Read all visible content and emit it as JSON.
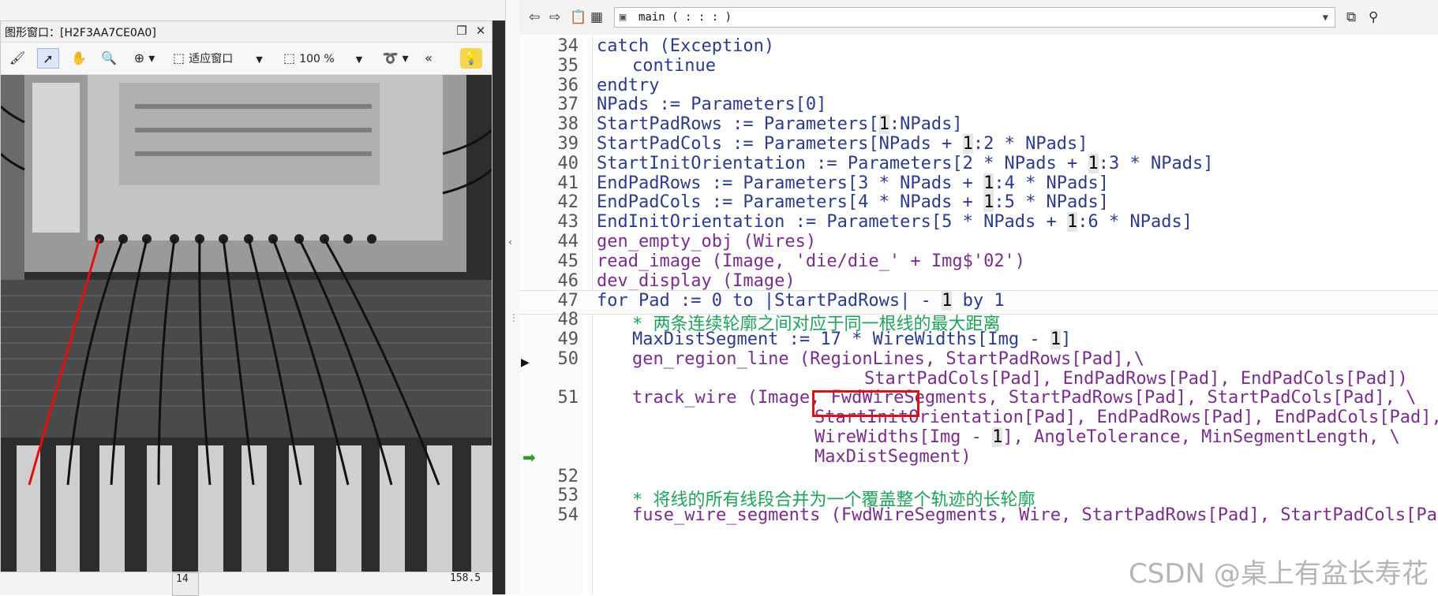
{
  "graphics_window": {
    "title": "图形窗口：[H2F3AA7CE0A0]",
    "tools": {
      "fit_label": "适应窗口",
      "zoom_label": "100 %",
      "more": "«"
    },
    "icons": [
      "restore-icon",
      "close-icon",
      "brush-icon",
      "pointer-icon",
      "hand-icon",
      "magnifier-icon",
      "zoom-in-icon",
      "fit-window-icon",
      "zoom-percent-icon",
      "lasso-icon",
      "lightbulb-icon"
    ]
  },
  "background_table": {
    "row_number": "14",
    "row_value": "158.5"
  },
  "editor": {
    "procedure": "main ( : : : )",
    "lines": [
      {
        "num": "34",
        "indent": 1,
        "parts": [
          {
            "t": "catch (Exception)",
            "c": "op"
          }
        ]
      },
      {
        "num": "35",
        "indent": 2,
        "parts": [
          {
            "t": "continue",
            "c": "op"
          }
        ]
      },
      {
        "num": "36",
        "indent": 1,
        "parts": [
          {
            "t": "endtry",
            "c": "op"
          }
        ]
      },
      {
        "num": "37",
        "indent": 1,
        "parts": [
          {
            "t": "NPads := Parameters[0]",
            "c": "op"
          }
        ]
      },
      {
        "num": "38",
        "indent": 1,
        "parts": [
          {
            "t": "StartPadRows := Parameters[",
            "c": "op"
          },
          {
            "t": "1",
            "c": "hl"
          },
          {
            "t": ":NPads]",
            "c": "op"
          }
        ]
      },
      {
        "num": "39",
        "indent": 1,
        "parts": [
          {
            "t": "StartPadCols := Parameters[NPads + ",
            "c": "op"
          },
          {
            "t": "1",
            "c": "hl"
          },
          {
            "t": ":2 * NPads]",
            "c": "op"
          }
        ]
      },
      {
        "num": "40",
        "indent": 1,
        "parts": [
          {
            "t": "StartInitOrientation := Parameters[2 * NPads + ",
            "c": "op"
          },
          {
            "t": "1",
            "c": "hl"
          },
          {
            "t": ":3 * NPads]",
            "c": "op"
          }
        ]
      },
      {
        "num": "41",
        "indent": 1,
        "parts": [
          {
            "t": "EndPadRows := Parameters[3 * NPads + ",
            "c": "op"
          },
          {
            "t": "1",
            "c": "hl"
          },
          {
            "t": ":4 * NPads]",
            "c": "op"
          }
        ]
      },
      {
        "num": "42",
        "indent": 1,
        "parts": [
          {
            "t": "EndPadCols := Parameters[4 * NPads + ",
            "c": "op"
          },
          {
            "t": "1",
            "c": "hl"
          },
          {
            "t": ":5 * NPads]",
            "c": "op"
          }
        ]
      },
      {
        "num": "43",
        "indent": 1,
        "parts": [
          {
            "t": "EndInitOrientation := Parameters[5 * NPads + ",
            "c": "op"
          },
          {
            "t": "1",
            "c": "hl"
          },
          {
            "t": ":6 * NPads]",
            "c": "op"
          }
        ]
      },
      {
        "num": "44",
        "indent": 1,
        "parts": [
          {
            "t": "gen_empty_obj (Wires)",
            "c": "kw"
          }
        ]
      },
      {
        "num": "45",
        "indent": 1,
        "parts": [
          {
            "t": "read_image (Image, 'die/die_' + Img$'02')",
            "c": "kw"
          }
        ]
      },
      {
        "num": "46",
        "indent": 1,
        "parts": [
          {
            "t": "dev_display (Image)",
            "c": "kw"
          }
        ]
      },
      {
        "num": "47",
        "indent": 1,
        "cur": true,
        "parts": [
          {
            "t": "for Pad := 0 to |StartPadRows| - ",
            "c": "op"
          },
          {
            "t": "1",
            "c": "hl"
          },
          {
            "t": " by 1",
            "c": "op"
          }
        ]
      },
      {
        "num": "48",
        "indent": 2,
        "parts": [
          {
            "t": "* 两条连续轮廓之间对应于同一根线的最大距离",
            "c": "cm"
          }
        ]
      },
      {
        "num": "49",
        "indent": 2,
        "parts": [
          {
            "t": "MaxDistSegment := 17 * WireWidths[Img - ",
            "c": "op"
          },
          {
            "t": "1",
            "c": "hl"
          },
          {
            "t": "]",
            "c": "op"
          }
        ]
      },
      {
        "num": "50",
        "indent": 2,
        "parts": [
          {
            "t": "gen_region_line (RegionLines, StartPadRows[Pad],\\",
            "c": "kw"
          }
        ]
      },
      {
        "num": "",
        "indent": 0,
        "pad": 339,
        "parts": [
          {
            "t": "StartPadCols[Pad], EndPadRows[Pad], EndPadCols[Pad])",
            "c": "kw"
          }
        ]
      },
      {
        "num": "51",
        "indent": 2,
        "parts": [
          {
            "t": "track_wire (Image, FwdWireSegments, StartPadRows[Pad], StartPadCols[Pad], \\",
            "c": "kw"
          }
        ]
      },
      {
        "num": "",
        "indent": 0,
        "pad": 276,
        "parts": [
          {
            "t": "StartInitOrientation[Pad], EndPadRows[Pad], EndPadCols[Pad], \\",
            "c": "kw"
          }
        ]
      },
      {
        "num": "",
        "indent": 0,
        "pad": 276,
        "parts": [
          {
            "t": "WireWidths[Img - ",
            "c": "kw"
          },
          {
            "t": "1",
            "c": "hl"
          },
          {
            "t": "], AngleTolerance, MinSegmentLength, \\",
            "c": "kw"
          }
        ]
      },
      {
        "num": "",
        "indent": 0,
        "pad": 276,
        "parts": [
          {
            "t": "MaxDistSegment)",
            "c": "kw"
          }
        ]
      },
      {
        "num": "52",
        "indent": 0,
        "parts": [
          {
            "t": "",
            "c": "op"
          }
        ]
      },
      {
        "num": "53",
        "indent": 2,
        "parts": [
          {
            "t": "* 将线的所有线段合并为一个覆盖整个轨迹的长轮廓",
            "c": "cm"
          }
        ]
      },
      {
        "num": "54",
        "indent": 2,
        "parts": [
          {
            "t": "fuse_wire_segments (FwdWireSegments, Wire, StartPadRows[Pad], StartPadCols[Pad",
            "c": "kw"
          }
        ]
      }
    ],
    "toolbar_icons": [
      "back-arrow-icon",
      "forward-arrow-icon",
      "clipboard-icon",
      "grid-icon",
      "procedure-icon",
      "window-icon",
      "pin-icon"
    ]
  },
  "watermark": "CSDN @桌上有盆长寿花",
  "colors": {
    "keyword": "#7a2d8f",
    "operator": "#2d3b8f",
    "comment": "#1fa35b",
    "highlight_box": "#e01010"
  }
}
